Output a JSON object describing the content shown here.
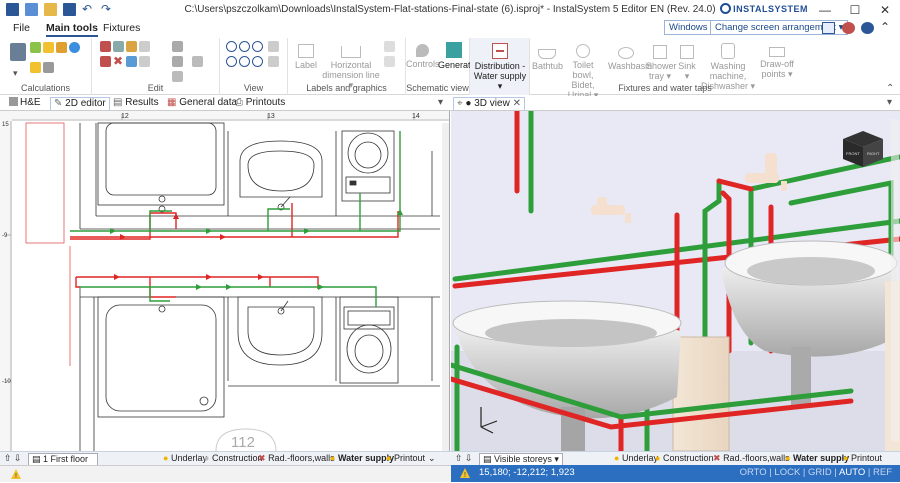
{
  "window": {
    "title": "C:\\Users\\pszczolkam\\Downloads\\InstalSystem-Flat-stations-Final-state (6).isproj* - InstalSystem 5 Editor EN (Rev. 24.0)",
    "brand": "INSTALSYSTEM"
  },
  "menu": {
    "file": "File",
    "main_tools": "Main tools",
    "fixtures": "Fixtures"
  },
  "toolbar_right": {
    "windows": "Windows",
    "arrangement": "Change screen arrangement"
  },
  "ribbon": {
    "groups": {
      "calculations": "Calculations",
      "edit": "Edit",
      "view": "View",
      "labels": "Labels and graphics",
      "schematic": "Schematic view",
      "fixtures": "Fixtures and water taps"
    },
    "buttons": {
      "label": "Label",
      "horizontal_dimension": "Horizontal dimension line",
      "controls": "Controls",
      "generate": "Generate",
      "distribution": "Distribution - Water supply",
      "bathtub": "Bathtub",
      "toilet": "Toilet bowl, Bidet, Urinal",
      "washbasin": "Washbasin",
      "shower": "Shower tray",
      "sink": "Sink",
      "washing": "Washing machine, Dishwasher",
      "drawoff": "Draw-off points"
    }
  },
  "tabs_left": [
    "H&E",
    "2D editor",
    "Results",
    "General data",
    "Printouts"
  ],
  "tab_right": "3D view",
  "ruler": {
    "top": [
      "12",
      "13",
      "14"
    ],
    "left": [
      "15",
      "-9",
      "-10"
    ]
  },
  "plan": {
    "room_number": "112"
  },
  "status_left": {
    "floor": "1 First floor",
    "underlay": "Underlay",
    "construction": "Construction",
    "rad_floors": "Rad.-floors,walls",
    "water_supply": "Water supply",
    "printout": "Printout"
  },
  "status_right": {
    "visible_storeys": "Visible storeys",
    "underlay": "Underlay",
    "construction": "Construction",
    "rad_floors": "Rad.-floors,walls",
    "water_supply": "Water supply",
    "printout": "Printout"
  },
  "bottom": {
    "coordinates": "15,180; -12,212; 1,923",
    "orto": "ORTO",
    "lock": "LOCK",
    "grid": "GRID",
    "auto": "AUTO",
    "ref": "REF"
  },
  "colors": {
    "accent": "#2c6fc0",
    "cold_pipe": "#2e9e3a",
    "hot_pipe": "#e02525",
    "cube_labels": [
      "FRONT",
      "RIGHT"
    ]
  }
}
